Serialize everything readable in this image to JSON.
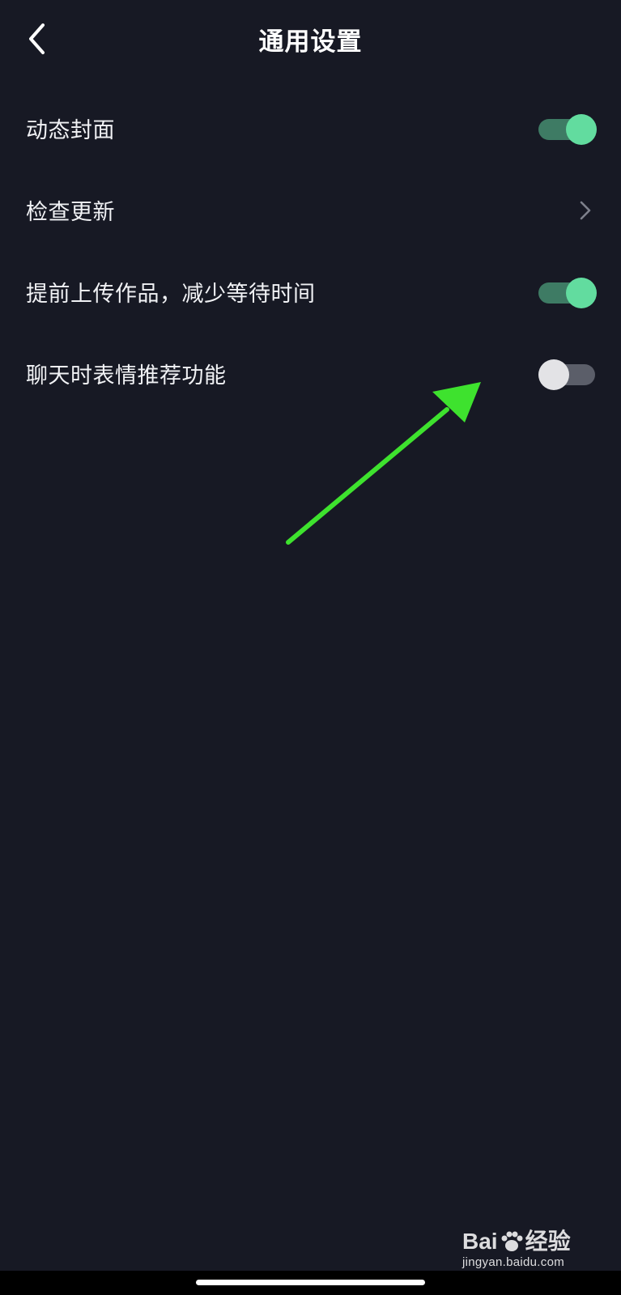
{
  "nav": {
    "title": "通用设置",
    "back_icon": "chevron-left-icon"
  },
  "settings": [
    {
      "label": "动态封面",
      "control": "toggle",
      "checked": true
    },
    {
      "label": "检查更新",
      "control": "chevron",
      "icon": "chevron-right-icon"
    },
    {
      "label": "提前上传作品，减少等待时间",
      "control": "toggle",
      "checked": true
    },
    {
      "label": "聊天时表情推荐功能",
      "control": "toggle",
      "checked": false
    }
  ],
  "colors": {
    "background": "#171924",
    "toggle_on_track": "#3e7b64",
    "toggle_on_knob": "#62dc9f",
    "toggle_off_track": "#5b5e69",
    "toggle_off_knob": "#e3e3e6",
    "annotation_arrow": "#3ee22e"
  },
  "watermark": {
    "brand_left": "Bai",
    "brand_right": "经验",
    "url": "jingyan.baidu.com"
  }
}
